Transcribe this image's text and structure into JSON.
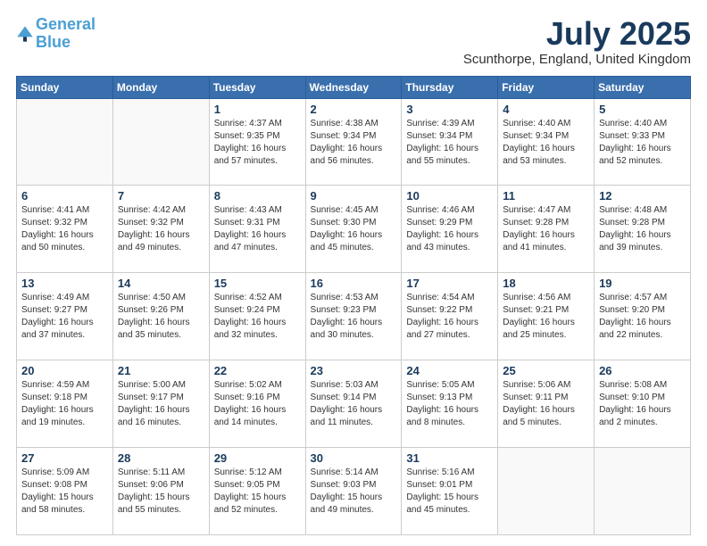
{
  "header": {
    "logo_line1": "General",
    "logo_line2": "Blue",
    "month": "July 2025",
    "location": "Scunthorpe, England, United Kingdom"
  },
  "weekdays": [
    "Sunday",
    "Monday",
    "Tuesday",
    "Wednesday",
    "Thursday",
    "Friday",
    "Saturday"
  ],
  "weeks": [
    [
      {
        "day": "",
        "info": ""
      },
      {
        "day": "",
        "info": ""
      },
      {
        "day": "1",
        "info": "Sunrise: 4:37 AM\nSunset: 9:35 PM\nDaylight: 16 hours\nand 57 minutes."
      },
      {
        "day": "2",
        "info": "Sunrise: 4:38 AM\nSunset: 9:34 PM\nDaylight: 16 hours\nand 56 minutes."
      },
      {
        "day": "3",
        "info": "Sunrise: 4:39 AM\nSunset: 9:34 PM\nDaylight: 16 hours\nand 55 minutes."
      },
      {
        "day": "4",
        "info": "Sunrise: 4:40 AM\nSunset: 9:34 PM\nDaylight: 16 hours\nand 53 minutes."
      },
      {
        "day": "5",
        "info": "Sunrise: 4:40 AM\nSunset: 9:33 PM\nDaylight: 16 hours\nand 52 minutes."
      }
    ],
    [
      {
        "day": "6",
        "info": "Sunrise: 4:41 AM\nSunset: 9:32 PM\nDaylight: 16 hours\nand 50 minutes."
      },
      {
        "day": "7",
        "info": "Sunrise: 4:42 AM\nSunset: 9:32 PM\nDaylight: 16 hours\nand 49 minutes."
      },
      {
        "day": "8",
        "info": "Sunrise: 4:43 AM\nSunset: 9:31 PM\nDaylight: 16 hours\nand 47 minutes."
      },
      {
        "day": "9",
        "info": "Sunrise: 4:45 AM\nSunset: 9:30 PM\nDaylight: 16 hours\nand 45 minutes."
      },
      {
        "day": "10",
        "info": "Sunrise: 4:46 AM\nSunset: 9:29 PM\nDaylight: 16 hours\nand 43 minutes."
      },
      {
        "day": "11",
        "info": "Sunrise: 4:47 AM\nSunset: 9:28 PM\nDaylight: 16 hours\nand 41 minutes."
      },
      {
        "day": "12",
        "info": "Sunrise: 4:48 AM\nSunset: 9:28 PM\nDaylight: 16 hours\nand 39 minutes."
      }
    ],
    [
      {
        "day": "13",
        "info": "Sunrise: 4:49 AM\nSunset: 9:27 PM\nDaylight: 16 hours\nand 37 minutes."
      },
      {
        "day": "14",
        "info": "Sunrise: 4:50 AM\nSunset: 9:26 PM\nDaylight: 16 hours\nand 35 minutes."
      },
      {
        "day": "15",
        "info": "Sunrise: 4:52 AM\nSunset: 9:24 PM\nDaylight: 16 hours\nand 32 minutes."
      },
      {
        "day": "16",
        "info": "Sunrise: 4:53 AM\nSunset: 9:23 PM\nDaylight: 16 hours\nand 30 minutes."
      },
      {
        "day": "17",
        "info": "Sunrise: 4:54 AM\nSunset: 9:22 PM\nDaylight: 16 hours\nand 27 minutes."
      },
      {
        "day": "18",
        "info": "Sunrise: 4:56 AM\nSunset: 9:21 PM\nDaylight: 16 hours\nand 25 minutes."
      },
      {
        "day": "19",
        "info": "Sunrise: 4:57 AM\nSunset: 9:20 PM\nDaylight: 16 hours\nand 22 minutes."
      }
    ],
    [
      {
        "day": "20",
        "info": "Sunrise: 4:59 AM\nSunset: 9:18 PM\nDaylight: 16 hours\nand 19 minutes."
      },
      {
        "day": "21",
        "info": "Sunrise: 5:00 AM\nSunset: 9:17 PM\nDaylight: 16 hours\nand 16 minutes."
      },
      {
        "day": "22",
        "info": "Sunrise: 5:02 AM\nSunset: 9:16 PM\nDaylight: 16 hours\nand 14 minutes."
      },
      {
        "day": "23",
        "info": "Sunrise: 5:03 AM\nSunset: 9:14 PM\nDaylight: 16 hours\nand 11 minutes."
      },
      {
        "day": "24",
        "info": "Sunrise: 5:05 AM\nSunset: 9:13 PM\nDaylight: 16 hours\nand 8 minutes."
      },
      {
        "day": "25",
        "info": "Sunrise: 5:06 AM\nSunset: 9:11 PM\nDaylight: 16 hours\nand 5 minutes."
      },
      {
        "day": "26",
        "info": "Sunrise: 5:08 AM\nSunset: 9:10 PM\nDaylight: 16 hours\nand 2 minutes."
      }
    ],
    [
      {
        "day": "27",
        "info": "Sunrise: 5:09 AM\nSunset: 9:08 PM\nDaylight: 15 hours\nand 58 minutes."
      },
      {
        "day": "28",
        "info": "Sunrise: 5:11 AM\nSunset: 9:06 PM\nDaylight: 15 hours\nand 55 minutes."
      },
      {
        "day": "29",
        "info": "Sunrise: 5:12 AM\nSunset: 9:05 PM\nDaylight: 15 hours\nand 52 minutes."
      },
      {
        "day": "30",
        "info": "Sunrise: 5:14 AM\nSunset: 9:03 PM\nDaylight: 15 hours\nand 49 minutes."
      },
      {
        "day": "31",
        "info": "Sunrise: 5:16 AM\nSunset: 9:01 PM\nDaylight: 15 hours\nand 45 minutes."
      },
      {
        "day": "",
        "info": ""
      },
      {
        "day": "",
        "info": ""
      }
    ]
  ]
}
